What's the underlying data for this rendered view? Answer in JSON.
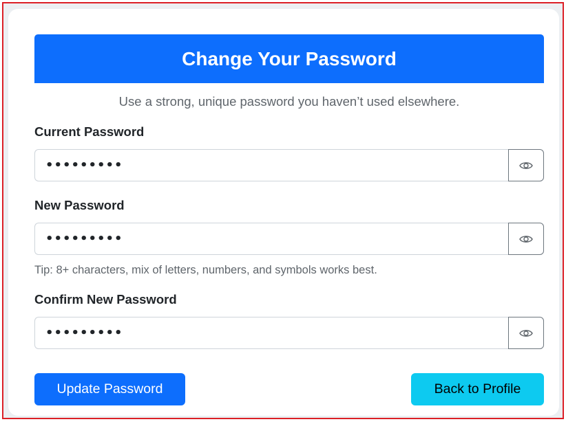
{
  "header": {
    "title": "Change Your Password"
  },
  "subtitle": "Use a strong, unique password you haven’t used elsewhere.",
  "fields": {
    "current": {
      "label": "Current Password",
      "value": "•••••••••"
    },
    "new": {
      "label": "New Password",
      "value": "•••••••••"
    },
    "confirm": {
      "label": "Confirm New Password",
      "value": "•••••••••"
    }
  },
  "tip": "Tip: 8+ characters, mix of letters, numbers, and symbols works best.",
  "buttons": {
    "update": "Update Password",
    "back": "Back to Profile"
  },
  "colors": {
    "primary": "#0d6efd",
    "info": "#0dcaf0",
    "frame_border": "#dc1f26"
  },
  "icons": {
    "toggle_visibility": "eye-icon"
  }
}
